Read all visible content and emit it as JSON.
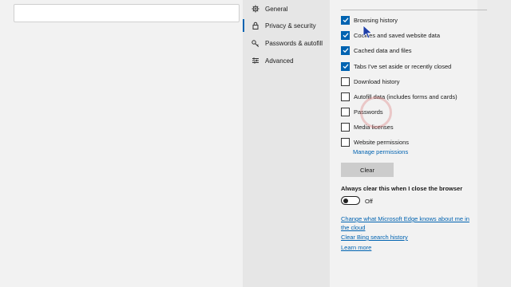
{
  "nav": {
    "items": [
      {
        "label": "General",
        "icon": "gear-icon"
      },
      {
        "label": "Privacy & security",
        "icon": "lock-icon"
      },
      {
        "label": "Passwords & autofill",
        "icon": "key-icon"
      },
      {
        "label": "Advanced",
        "icon": "sliders-icon"
      }
    ]
  },
  "clear_data": {
    "options": [
      {
        "label": "Browsing history",
        "checked": true
      },
      {
        "label": "Cookies and saved website data",
        "checked": true
      },
      {
        "label": "Cached data and files",
        "checked": true
      },
      {
        "label": "Tabs I've set aside or recently closed",
        "checked": true
      },
      {
        "label": "Download history",
        "checked": false
      },
      {
        "label": "Autofill data (includes forms and cards)",
        "checked": false
      },
      {
        "label": "Passwords",
        "checked": false
      },
      {
        "label": "Media licenses",
        "checked": false
      },
      {
        "label": "Website permissions",
        "checked": false
      }
    ],
    "manage_permissions_link": "Manage permissions",
    "clear_button_label": "Clear",
    "always_clear_heading": "Always clear this when I close the browser",
    "toggle_state": "Off",
    "toggle_on": false
  },
  "links": {
    "change_what_edge_knows_line1": "Change what Microsoft Edge knows about me in",
    "change_what_edge_knows_line2": "the cloud",
    "clear_bing_history": "Clear Bing search history",
    "learn_more": "Learn more"
  },
  "colors": {
    "accent": "#0063b1",
    "nav_background": "#e6e6e6",
    "panel_background": "#f2f2f2"
  }
}
